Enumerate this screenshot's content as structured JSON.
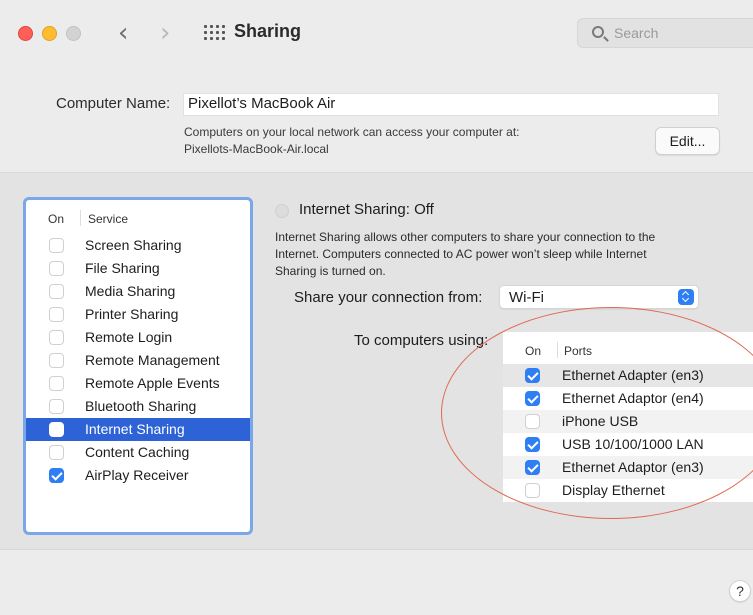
{
  "window": {
    "title": "Sharing",
    "search_placeholder": "Search"
  },
  "computer_name": {
    "label": "Computer Name:",
    "value": "Pixellot’s MacBook Air",
    "description_line1": "Computers on your local network can access your computer at:",
    "description_line2": "Pixellots-MacBook-Air.local",
    "edit_label": "Edit..."
  },
  "services": {
    "header_on": "On",
    "header_service": "Service",
    "items": [
      {
        "label": "Screen Sharing",
        "checked": false
      },
      {
        "label": "File Sharing",
        "checked": false
      },
      {
        "label": "Media Sharing",
        "checked": false
      },
      {
        "label": "Printer Sharing",
        "checked": false
      },
      {
        "label": "Remote Login",
        "checked": false
      },
      {
        "label": "Remote Management",
        "checked": false
      },
      {
        "label": "Remote Apple Events",
        "checked": false
      },
      {
        "label": "Bluetooth Sharing",
        "checked": false
      },
      {
        "label": "Internet Sharing",
        "checked": false,
        "selected": true
      },
      {
        "label": "Content Caching",
        "checked": false
      },
      {
        "label": "AirPlay Receiver",
        "checked": true
      }
    ]
  },
  "internet_sharing": {
    "status": "Internet Sharing: Off",
    "desc_line1": "Internet Sharing allows other computers to share your connection to the",
    "desc_line2": "Internet. Computers connected to AC power won’t sleep while Internet",
    "desc_line3": "Sharing is turned on.",
    "share_from_label": "Share your connection from:",
    "share_from_value": "Wi-Fi",
    "to_computers_label": "To computers using:"
  },
  "ports": {
    "header_on": "On",
    "header_ports": "Ports",
    "items": [
      {
        "label": "Ethernet Adapter (en3)",
        "checked": true
      },
      {
        "label": "Ethernet Adaptor (en4)",
        "checked": true
      },
      {
        "label": "iPhone USB",
        "checked": false
      },
      {
        "label": "USB 10/100/1000 LAN",
        "checked": true
      },
      {
        "label": "Ethernet Adaptor (en3)",
        "checked": true
      },
      {
        "label": "Display Ethernet",
        "checked": false
      }
    ]
  },
  "help_label": "?",
  "colors": {
    "accent": "#2f7ff4",
    "selection": "#2d63d6",
    "list_border": "#7aa7ea",
    "annotation": "#e06a55"
  }
}
